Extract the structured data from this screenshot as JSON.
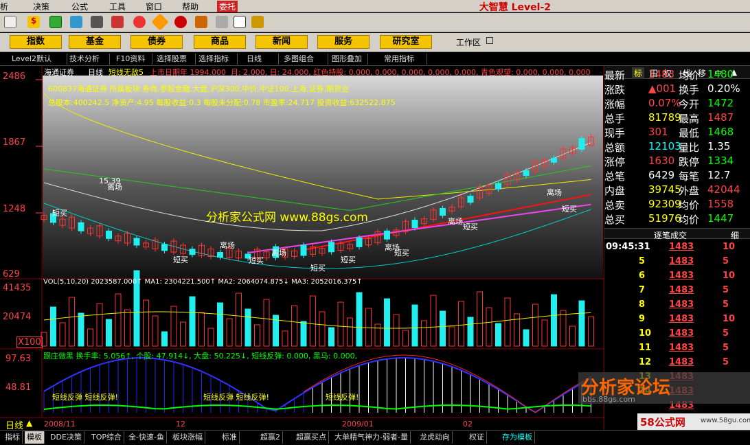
{
  "menu": {
    "items": [
      "析",
      "决策",
      "公式",
      "工具",
      "窗口",
      "帮助",
      "委托"
    ],
    "brand": "大智慧 Level-2"
  },
  "nav": {
    "buttons": [
      "指数",
      "基金",
      "债券",
      "商品",
      "新闻",
      "服务",
      "研究室"
    ],
    "workarea": "工作区"
  },
  "options": {
    "items": [
      "Level2默认",
      "技术分析",
      "F10资料",
      "选择股票",
      "选择指标",
      "日线",
      "多图组合",
      "图形叠加",
      "常用指标"
    ]
  },
  "chart": {
    "stock": "海通证券",
    "period": "日线",
    "indicator": "短线无敌5",
    "market_date": "上市日期年 1994.000",
    "info": "月: 2.000, 日: 24.000, 红色持股: 0.000, 0.000, 0.000, 0.000, 0.000, 青色观望: 0.000, 0.000, 0.000",
    "line1": "600837海通证券 所属板块:券商,参股金融,大盘,沪深300,中价,中证100,上海,证券,期货业",
    "line2": "总股本:400242.5 净资产:4.95 每股收益:0.3 每股未分配:0.78 市盈率:24.717 投资收益:632522.875",
    "price_labels": [
      "2486",
      "1867",
      "1248",
      "629"
    ],
    "peak": "15.39",
    "vol_labels": [
      "41435",
      "20474",
      "X100"
    ],
    "ind_labels": [
      "97.63",
      "48.81"
    ],
    "vol_legend": "VOL(5,10,20) 2023587.000↑ MA1: 2304221.500↑ MA2: 2064074.875↓ MA3: 2052016.375↑",
    "ind_legend": "跟庄做黑 换手率: 5.056↑, 个股: 47.914↓, 大盘: 50.225↓, 短线反弹: 0.000, 黑马: 0.000,",
    "dates": [
      "2008/11",
      "12",
      "2009/01",
      "02"
    ],
    "period_label": "日线",
    "signals": [
      "短买",
      "离场",
      "短买",
      "离场",
      "短买",
      "短买",
      "离场",
      "短买",
      "离场",
      "短买",
      "离场",
      "短买",
      "离场",
      "短买"
    ],
    "rebound": [
      "短线反弹 短线反弹!",
      "短线反弹 短线反弹!",
      "短线反弹!"
    ],
    "watermark": "分析家公式网 www.88gs.com"
  },
  "quote": {
    "tabs": [
      "标",
      "田",
      "权",
      "线",
      "移"
    ],
    "rows": [
      [
        "最新",
        "1483",
        "均价",
        "1480"
      ],
      [
        "涨跌",
        "▲001",
        "换手",
        "0.20%"
      ],
      [
        "涨幅",
        "0.07%",
        "今开",
        "1472"
      ],
      [
        "总手",
        "81789",
        "最高",
        "1487"
      ],
      [
        "现手",
        "301",
        "最低",
        "1468"
      ],
      [
        "总额",
        "12103",
        "量比",
        "1.35"
      ],
      [
        "涨停",
        "1630",
        "跌停",
        "1334"
      ],
      [
        "总笔",
        "6429",
        "每笔",
        "12.7"
      ],
      [
        "内盘",
        "39745",
        "外盘",
        "42044"
      ],
      [
        "总卖",
        "92309",
        "均价",
        "1558"
      ],
      [
        "总买",
        "51976",
        "均价",
        "1447"
      ]
    ],
    "ticks_title": "逐笔成交",
    "ticks_flag": "细",
    "ticks": [
      [
        "09:45:31",
        "1483",
        "10"
      ],
      [
        "5",
        "1483",
        "5"
      ],
      [
        "6",
        "1483",
        "10"
      ],
      [
        "7",
        "1483",
        "5"
      ],
      [
        "8",
        "1483",
        "5"
      ],
      [
        "9",
        "1483",
        "10"
      ],
      [
        "10",
        "1483",
        "5"
      ],
      [
        "11",
        "1483",
        "5"
      ],
      [
        "12",
        "1483",
        "5"
      ],
      [
        "13",
        "1483",
        ""
      ],
      [
        "14",
        "1483",
        ""
      ],
      [
        "",
        "1483",
        ""
      ]
    ],
    "logo": "分析家论坛",
    "logo_url": "bbs.88gs.com",
    "site": "58公式网",
    "site_url": "www.58gu.com"
  },
  "bottom": {
    "tabs": [
      "指标",
      "模板",
      "DDE决策",
      "TOP综合",
      "全-快速-鱼",
      "板块涨幅",
      "标准",
      "超赢2",
      "超赢买点",
      "大单精气神力-弱者-量",
      "龙虎动向",
      "权证",
      "存为模板"
    ]
  }
}
